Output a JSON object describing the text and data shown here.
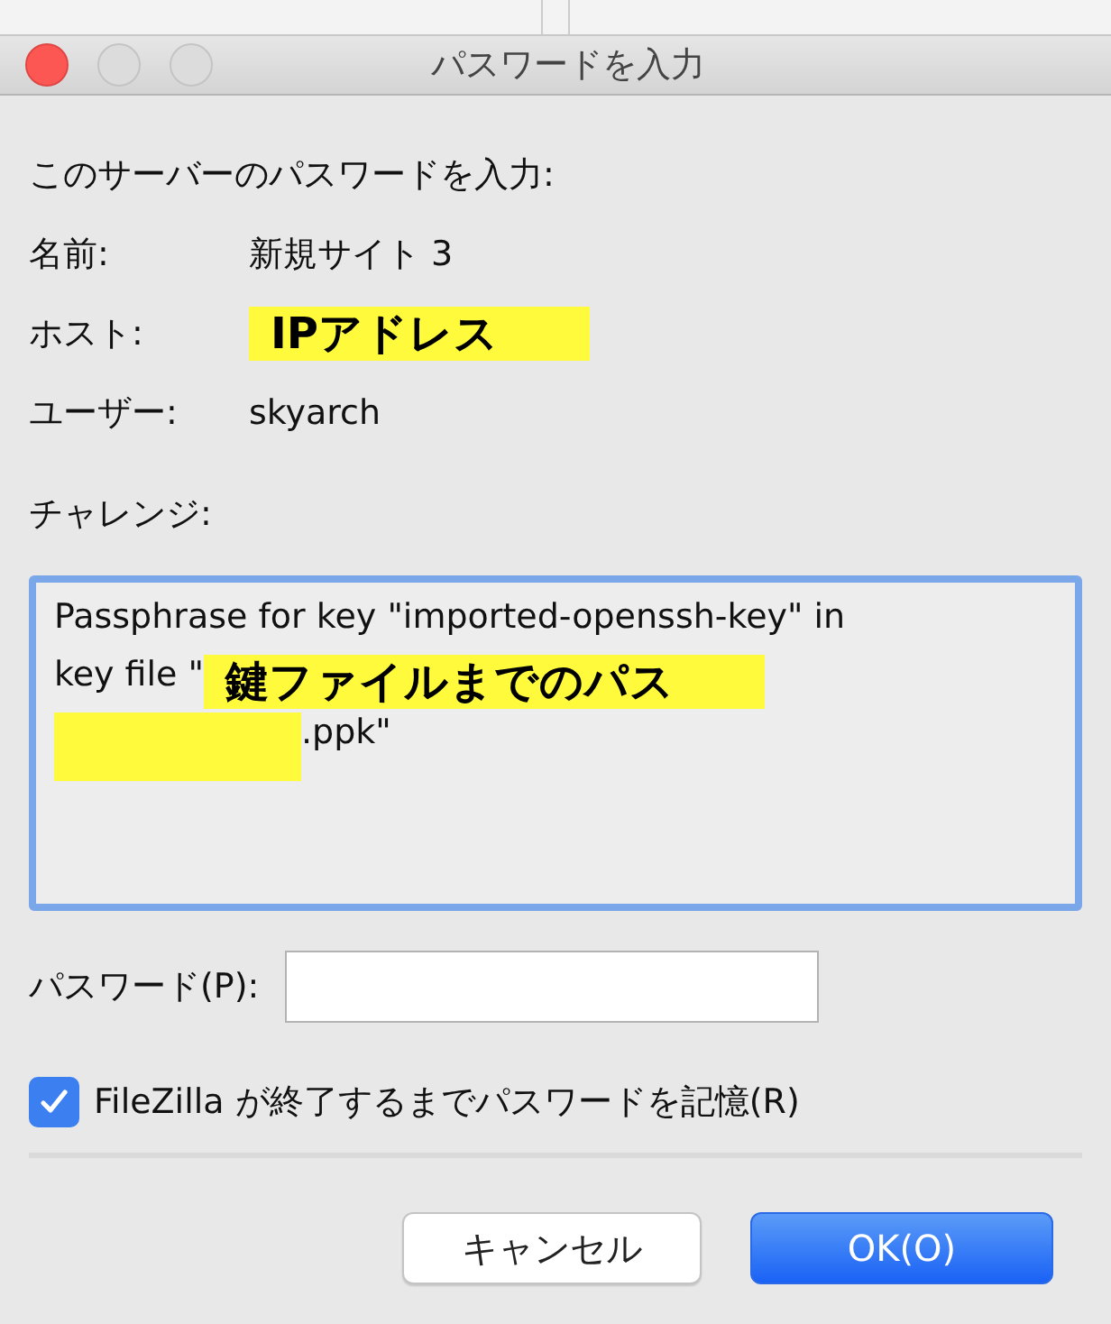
{
  "window": {
    "title": "パスワードを入力"
  },
  "prompt": "このサーバーのパスワードを入力:",
  "fields": [
    {
      "label": "名前:",
      "segments": [
        {
          "kind": "text",
          "text": "新規サイト 3"
        }
      ]
    },
    {
      "label": "ホスト:",
      "segments": [
        {
          "kind": "annotation",
          "text": "IPアドレス"
        }
      ]
    },
    {
      "label": "ユーザー:",
      "segments": [
        {
          "kind": "text",
          "text": "skyarch"
        }
      ]
    }
  ],
  "challenge": {
    "label": "チャレンジ:",
    "lines": [
      [
        {
          "kind": "text",
          "text": "Passphrase for key \"imported-openssh-key\" in"
        }
      ],
      [
        {
          "kind": "text",
          "text": "key file \""
        },
        {
          "kind": "annotation",
          "text": "鍵ファイルまでのパス"
        }
      ],
      [
        {
          "kind": "blank"
        },
        {
          "kind": "text",
          "text": ".ppk\""
        }
      ]
    ]
  },
  "password": {
    "label": "パスワード(P):"
  },
  "remember": {
    "label": "FileZilla が終了するまでパスワードを記憶(R)",
    "checked": true
  },
  "buttons": [
    {
      "label": "キャンセル",
      "kind": "default"
    },
    {
      "label": "OK(O)",
      "kind": "primary"
    }
  ]
}
